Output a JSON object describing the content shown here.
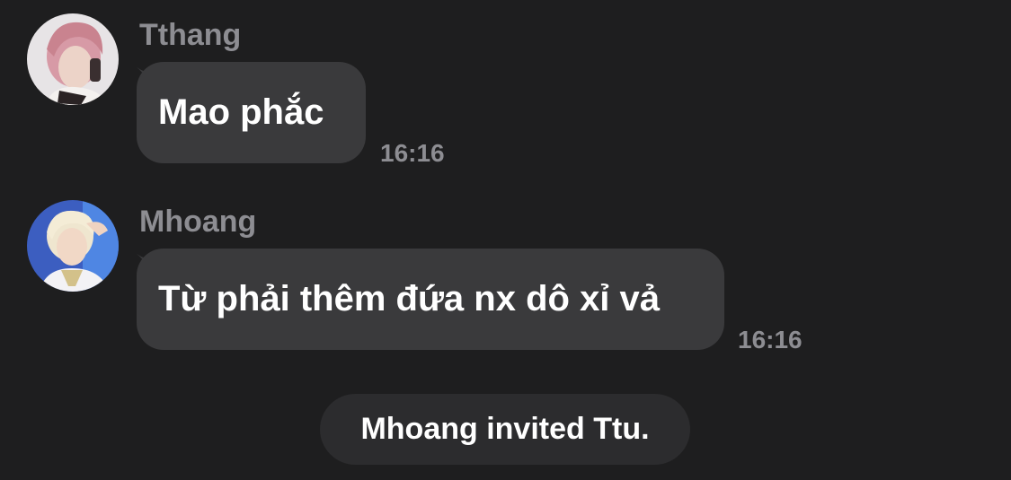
{
  "messages": [
    {
      "sender": "Tthang",
      "text": "Mao phắc",
      "time": "16:16",
      "avatar_icon": "pink-haired-person-avatar"
    },
    {
      "sender": "Mhoang",
      "text": "Từ phải thêm đứa nx dô xỉ vả",
      "time": "16:16",
      "avatar_icon": "blonde-person-avatar"
    }
  ],
  "system_notice": "Mhoang invited Ttu.",
  "colors": {
    "background": "#1e1e1f",
    "bubble": "#3a3a3c",
    "system_pill": "#2c2c2e",
    "secondary_text": "#8d8d92",
    "primary_text": "#ffffff"
  }
}
